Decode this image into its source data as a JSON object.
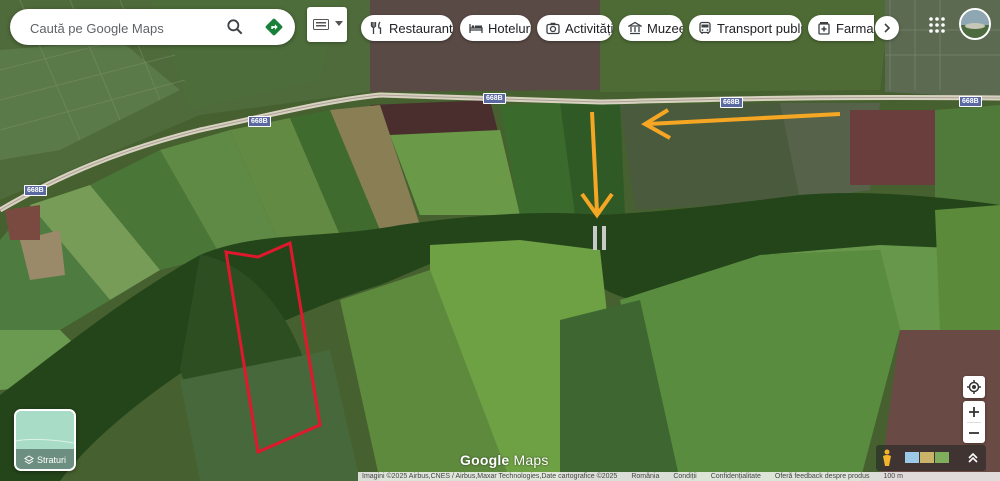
{
  "search": {
    "placeholder": "Caută pe Google Maps"
  },
  "categories": [
    {
      "label": "Restaurante",
      "icon": "fork-knife-icon"
    },
    {
      "label": "Hoteluri",
      "icon": "bed-icon"
    },
    {
      "label": "Activități",
      "icon": "camera-icon"
    },
    {
      "label": "Muzee",
      "icon": "museum-icon"
    },
    {
      "label": "Transport public",
      "icon": "bus-icon"
    },
    {
      "label": "Farmacii",
      "icon": "pharmacy-icon"
    }
  ],
  "map": {
    "road_labels": [
      "668B",
      "668B",
      "668B",
      "668B",
      "668B"
    ],
    "annotations": {
      "arrow_color": "#f5a623",
      "plot_outline_color": "#e0182d"
    }
  },
  "layers_label": "Straturi",
  "logo": {
    "google": "Google",
    "maps": "Maps"
  },
  "footer": {
    "attribution": "Imagini ©2025 Airbus,CNES / Airbus,Maxar Technologies,Date cartografice ©2025",
    "country": "România",
    "terms": "Condiții",
    "privacy": "Confidențialitate",
    "feedback": "Oferă feedback despre produs",
    "scale": "100 m"
  },
  "colors": {
    "accent": "#1a73e8",
    "directions": "#188038"
  }
}
